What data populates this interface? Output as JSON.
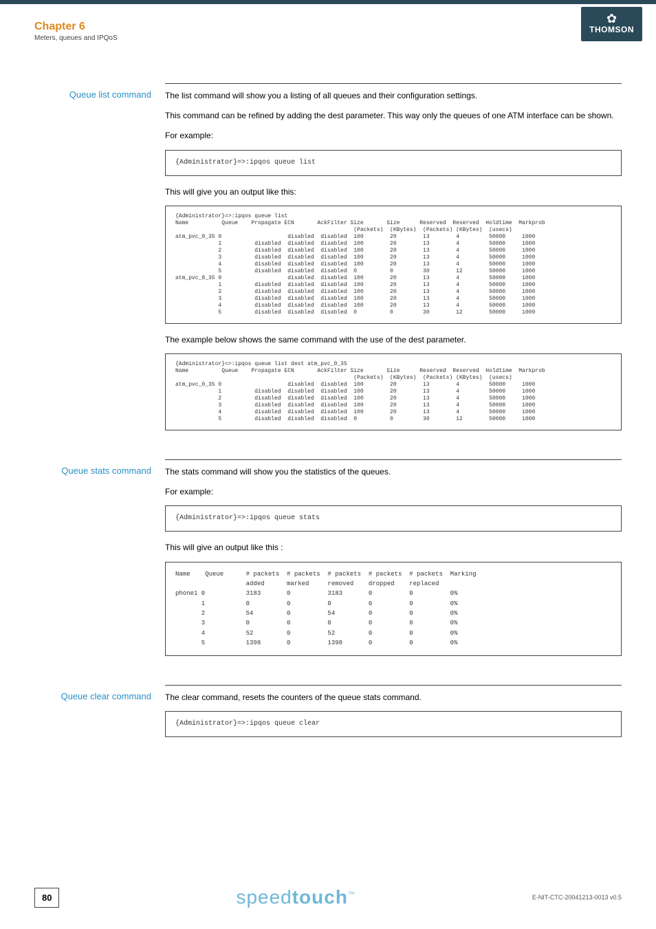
{
  "header": {
    "chapter": "Chapter 6",
    "subtitle": "Meters, queues and IPQoS",
    "brand": "THOMSON",
    "brand_symbol": "✿"
  },
  "sections": {
    "queue_list": {
      "label": "Queue list command",
      "p1": "The list command will show you a listing of all queues and their configuration settings.",
      "p2": "This command can be refined by adding the dest parameter. This way only the queues of one ATM interface can be shown.",
      "p3": "For example:",
      "cmd1": "{Administrator}=>:ipqos queue list",
      "p4": "This will give you an output like this:",
      "out1": "{Administrator}=>:ipqos queue list\nName          Queue    Propagate ECN       AckFilter Size       Size      Reserved  Reserved  Holdtime  Markprob\n                                                      (Packets)  (KBytes)  (Packets) (KBytes)  (usecs)\natm_pvc_0_35 0                    disabled  disabled  100        20        13        4         50000     1000\n             1          disabled  disabled  disabled  100        20        13        4         50000     1000\n             2          disabled  disabled  disabled  100        20        13        4         50000     1000\n             3          disabled  disabled  disabled  100        20        13        4         50000     1000\n             4          disabled  disabled  disabled  100        20        13        4         50000     1000\n             5          disabled  disabled  disabled  0          0         30        12        50000     1000\natm_pvc_8_35 0                    disabled  disabled  100        20        13        4         50000     1000\n             1          disabled  disabled  disabled  100        20        13        4         50000     1000\n             2          disabled  disabled  disabled  100        20        13        4         50000     1000\n             3          disabled  disabled  disabled  100        20        13        4         50000     1000\n             4          disabled  disabled  disabled  100        20        13        4         50000     1000\n             5          disabled  disabled  disabled  0          0         30        12        50000     1000",
      "p5": "The example below shows the same command with the use of the dest parameter.",
      "out2": "{Administrator}=>:ipqos queue list dest atm_pvc_0_35\nName          Queue    Propagate ECN       AckFilter Size       Size      Reserved  Reserved  Holdtime  Markprob\n                                                      (Packets)  (KBytes)  (Packets) (KBytes)  (usecs)\natm_pvc_0_35 0                    disabled  disabled  100        20        13        4         50000     1000\n             1          disabled  disabled  disabled  100        20        13        4         50000     1000\n             2          disabled  disabled  disabled  100        20        13        4         50000     1000\n             3          disabled  disabled  disabled  100        20        13        4         50000     1000\n             4          disabled  disabled  disabled  100        20        13        4         50000     1000\n             5          disabled  disabled  disabled  0          0         30        12        50000     1000"
    },
    "queue_stats": {
      "label": "Queue stats command",
      "p1": "The stats command will show you the statistics of the queues.",
      "p2": "For example:",
      "cmd1": "{Administrator}=>:ipqos queue stats",
      "p3": "This will give an output like this :",
      "out1": "Name    Queue      # packets  # packets  # packets  # packets  # packets  Marking\n                   added      marked     removed    dropped    replaced\nphone1 0           3183       0          3183       0          0          0%\n       1           0          0          0          0          0          0%\n       2           54         0          54         0          0          0%\n       3           0          0          0          0          0          0%\n       4           52         0          52         0          0          0%\n       5           1398       0          1398       0          0          0%"
    },
    "queue_clear": {
      "label": "Queue clear command",
      "p1": "The clear command, resets the counters of the queue stats command.",
      "cmd1": "{Administrator}=>:ipqos queue clear"
    }
  },
  "footer": {
    "page": "80",
    "brand_thin": "speed",
    "brand_bold": "touch",
    "tm": "™",
    "docref": "E-NIT-CTC-20041213-0013 v0.5"
  }
}
